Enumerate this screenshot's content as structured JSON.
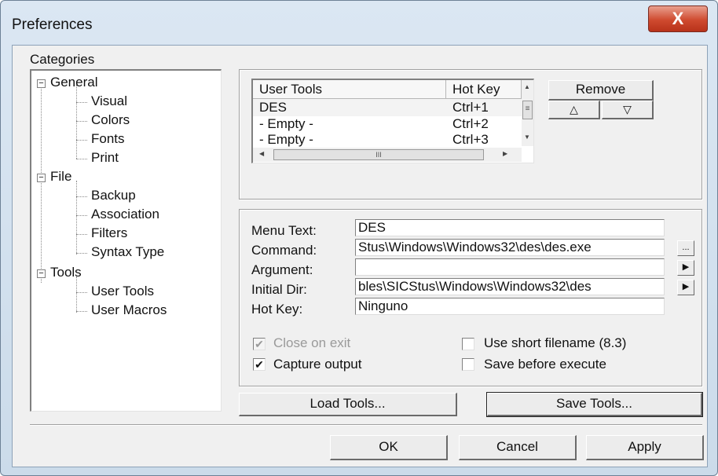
{
  "window": {
    "title": "Preferences",
    "close_glyph": "X"
  },
  "categories": {
    "label": "Categories",
    "tree": [
      {
        "label": "General",
        "toggle": "−",
        "children": [
          "Visual",
          "Colors",
          "Fonts",
          "Print"
        ]
      },
      {
        "label": "File",
        "toggle": "−",
        "children": [
          "Backup",
          "Association",
          "Filters",
          "Syntax Type"
        ]
      },
      {
        "label": "Tools",
        "toggle": "−",
        "children": [
          "User Tools",
          "User Macros"
        ]
      }
    ]
  },
  "user_tools_list": {
    "columns": [
      "User Tools",
      "Hot Key"
    ],
    "rows": [
      {
        "tool": "DES",
        "hotkey": "Ctrl+1"
      },
      {
        "tool": "- Empty -",
        "hotkey": "Ctrl+2"
      },
      {
        "tool": "- Empty -",
        "hotkey": "Ctrl+3"
      }
    ],
    "hscroll_grip": "III",
    "vscroll_grip": "≡",
    "arrow_up": "▲",
    "arrow_down": "▼",
    "arrow_left": "◀",
    "arrow_right": "▶"
  },
  "list_buttons": {
    "remove": "Remove",
    "move_up": "△",
    "move_down": "▽"
  },
  "details": {
    "menu_text": {
      "label": "Menu Text:",
      "value": "DES"
    },
    "command": {
      "label": "Command:",
      "value": "Stus\\Windows\\Windows32\\des\\des.exe",
      "button": "..."
    },
    "argument": {
      "label": "Argument:",
      "value": "",
      "button": "▶"
    },
    "initial_dir": {
      "label": "Initial Dir:",
      "value": "bles\\SICStus\\Windows\\Windows32\\des",
      "button": "▶"
    },
    "hot_key": {
      "label": "Hot Key:",
      "value": "Ninguno"
    }
  },
  "options": {
    "close_on_exit": {
      "label": "Close on exit",
      "checked": true,
      "enabled": false
    },
    "capture_output": {
      "label": "Capture output",
      "checked": true,
      "enabled": true
    },
    "use_short_filename": {
      "label": "Use short filename (8.3)",
      "checked": false,
      "enabled": true
    },
    "save_before_execute": {
      "label": "Save before execute",
      "checked": false,
      "enabled": true
    },
    "check_glyph": "✔"
  },
  "tool_buttons": {
    "load": "Load Tools...",
    "save": "Save Tools..."
  },
  "dialog_buttons": {
    "ok": "OK",
    "cancel": "Cancel",
    "apply": "Apply"
  }
}
